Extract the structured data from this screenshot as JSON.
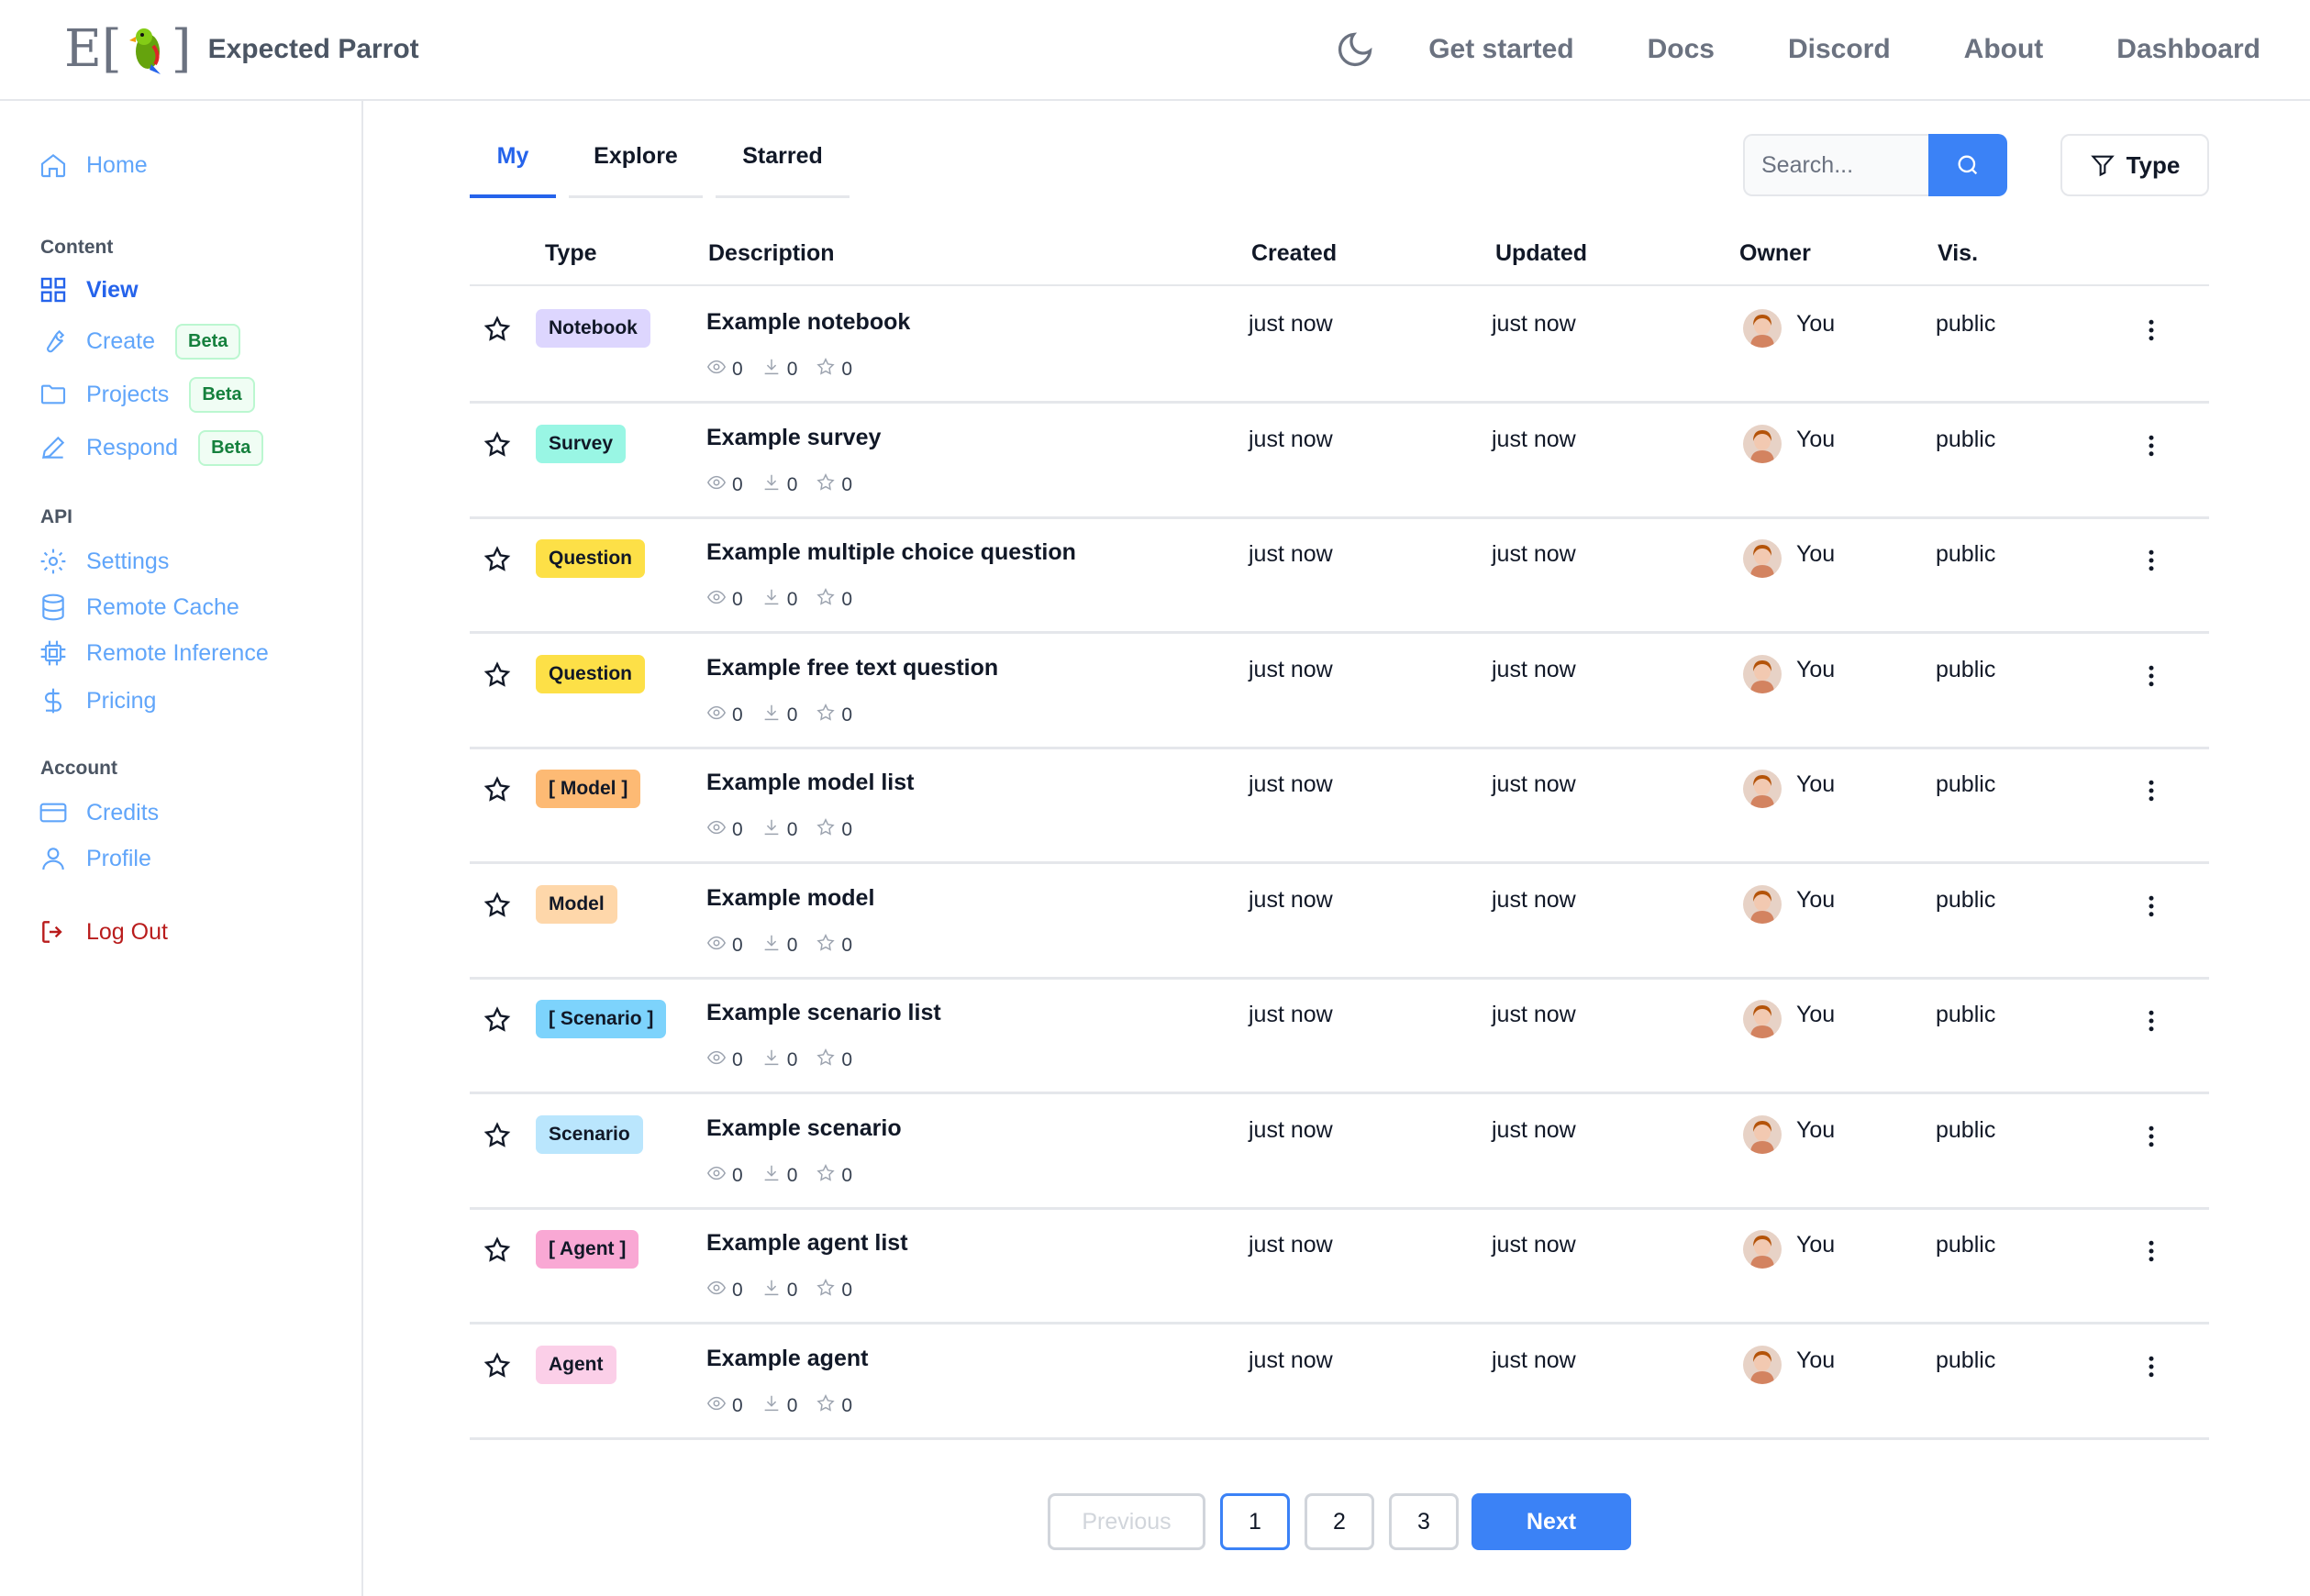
{
  "app": {
    "brand": "Expected Parrot",
    "logo_text": "E[🦜]"
  },
  "nav": {
    "links": [
      "Get started",
      "Docs",
      "Discord",
      "About",
      "Dashboard"
    ]
  },
  "sidebar": {
    "home": "Home",
    "sections": [
      {
        "title": "Content",
        "items": [
          {
            "label": "View",
            "icon": "grid-icon",
            "active": true
          },
          {
            "label": "Create",
            "icon": "wrench-icon",
            "badge": "Beta"
          },
          {
            "label": "Projects",
            "icon": "folder-icon",
            "badge": "Beta"
          },
          {
            "label": "Respond",
            "icon": "pencil-icon",
            "badge": "Beta"
          }
        ]
      },
      {
        "title": "API",
        "items": [
          {
            "label": "Settings",
            "icon": "gear-icon"
          },
          {
            "label": "Remote Cache",
            "icon": "database-icon"
          },
          {
            "label": "Remote Inference",
            "icon": "chip-icon"
          },
          {
            "label": "Pricing",
            "icon": "dollar-icon"
          }
        ]
      },
      {
        "title": "Account",
        "items": [
          {
            "label": "Credits",
            "icon": "credit-card-icon"
          },
          {
            "label": "Profile",
            "icon": "user-icon"
          }
        ]
      }
    ],
    "logout": "Log Out"
  },
  "tabs": [
    "My",
    "Explore",
    "Starred"
  ],
  "active_tab": "My",
  "search": {
    "placeholder": "Search..."
  },
  "type_filter": "Type",
  "table": {
    "headers": [
      "Type",
      "Description",
      "Created",
      "Updated",
      "Owner",
      "Vis."
    ],
    "rows": [
      {
        "type": "Notebook",
        "color": "#ddd6fe",
        "description": "Example notebook",
        "views": "0",
        "downloads": "0",
        "stars": "0",
        "created": "just now",
        "updated": "just now",
        "owner": "You",
        "visibility": "public"
      },
      {
        "type": "Survey",
        "color": "#99f6e4",
        "description": "Example survey",
        "views": "0",
        "downloads": "0",
        "stars": "0",
        "created": "just now",
        "updated": "just now",
        "owner": "You",
        "visibility": "public"
      },
      {
        "type": "Question",
        "color": "#fde047",
        "description": "Example multiple choice question",
        "views": "0",
        "downloads": "0",
        "stars": "0",
        "created": "just now",
        "updated": "just now",
        "owner": "You",
        "visibility": "public"
      },
      {
        "type": "Question",
        "color": "#fde047",
        "description": "Example free text question",
        "views": "0",
        "downloads": "0",
        "stars": "0",
        "created": "just now",
        "updated": "just now",
        "owner": "You",
        "visibility": "public"
      },
      {
        "type": "[ Model ]",
        "color": "#fdba74",
        "description": "Example model list",
        "views": "0",
        "downloads": "0",
        "stars": "0",
        "created": "just now",
        "updated": "just now",
        "owner": "You",
        "visibility": "public"
      },
      {
        "type": "Model",
        "color": "#fed7aa",
        "description": "Example model",
        "views": "0",
        "downloads": "0",
        "stars": "0",
        "created": "just now",
        "updated": "just now",
        "owner": "You",
        "visibility": "public"
      },
      {
        "type": "[ Scenario ]",
        "color": "#7dd3fc",
        "description": "Example scenario list",
        "views": "0",
        "downloads": "0",
        "stars": "0",
        "created": "just now",
        "updated": "just now",
        "owner": "You",
        "visibility": "public"
      },
      {
        "type": "Scenario",
        "color": "#bae6fd",
        "description": "Example scenario",
        "views": "0",
        "downloads": "0",
        "stars": "0",
        "created": "just now",
        "updated": "just now",
        "owner": "You",
        "visibility": "public"
      },
      {
        "type": "[ Agent ]",
        "color": "#f9a8d4",
        "description": "Example agent list",
        "views": "0",
        "downloads": "0",
        "stars": "0",
        "created": "just now",
        "updated": "just now",
        "owner": "You",
        "visibility": "public"
      },
      {
        "type": "Agent",
        "color": "#fbcfe8",
        "description": "Example agent",
        "views": "0",
        "downloads": "0",
        "stars": "0",
        "created": "just now",
        "updated": "just now",
        "owner": "You",
        "visibility": "public"
      }
    ]
  },
  "pagination": {
    "previous": "Previous",
    "pages": [
      "1",
      "2",
      "3"
    ],
    "current": "1",
    "next": "Next"
  }
}
